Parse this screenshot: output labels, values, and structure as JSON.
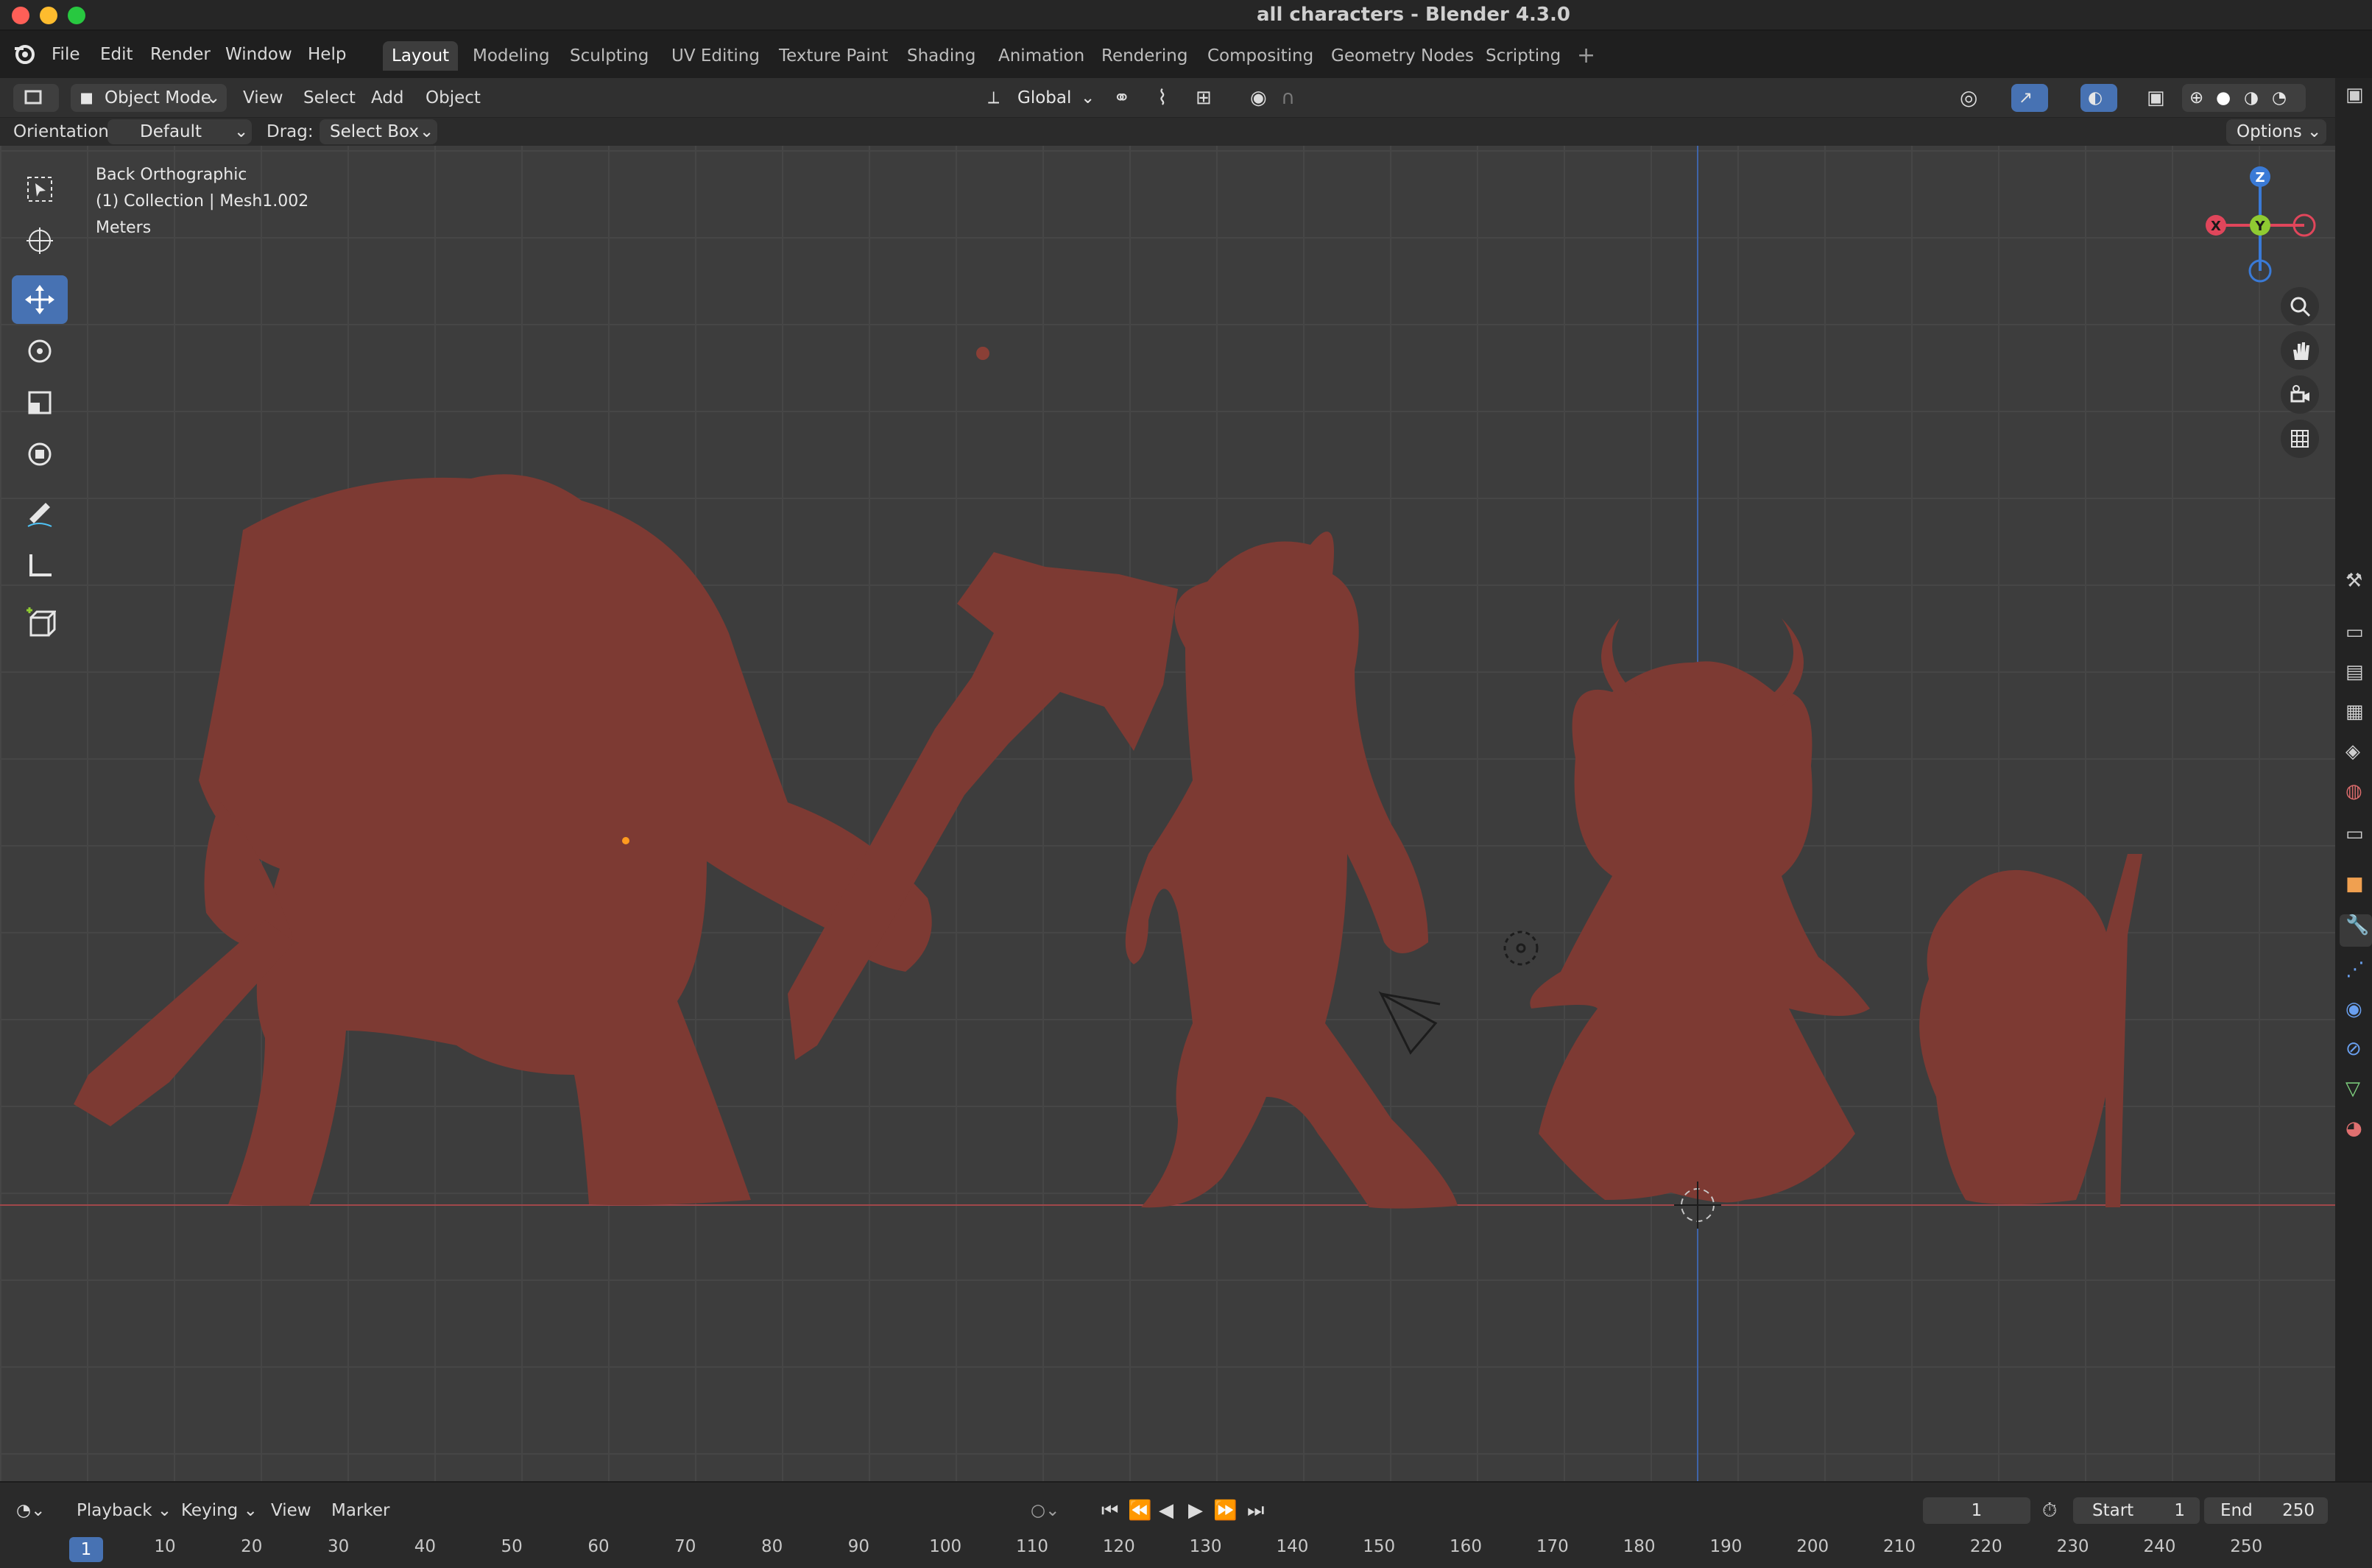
{
  "window": {
    "title": "all characters - Blender 4.3.0"
  },
  "menu": [
    {
      "name": "file",
      "label": "File"
    },
    {
      "name": "edit",
      "label": "Edit"
    },
    {
      "name": "render",
      "label": "Render"
    },
    {
      "name": "window",
      "label": "Window"
    },
    {
      "name": "help",
      "label": "Help"
    }
  ],
  "workspaces": [
    {
      "name": "layout",
      "label": "Layout"
    },
    {
      "name": "modeling",
      "label": "Modeling"
    },
    {
      "name": "sculpting",
      "label": "Sculpting"
    },
    {
      "name": "uv-editing",
      "label": "UV Editing"
    },
    {
      "name": "texture-paint",
      "label": "Texture Paint"
    },
    {
      "name": "shading",
      "label": "Shading"
    },
    {
      "name": "animation",
      "label": "Animation"
    },
    {
      "name": "rendering",
      "label": "Rendering"
    },
    {
      "name": "compositing",
      "label": "Compositing"
    },
    {
      "name": "geometry-nodes",
      "label": "Geometry Nodes"
    },
    {
      "name": "scripting",
      "label": "Scripting"
    }
  ],
  "header": {
    "mode": "Object Mode",
    "view": "View",
    "select": "Select",
    "add": "Add",
    "object": "Object",
    "transform": "Global"
  },
  "tool_settings": {
    "orientation_label": "Orientation:",
    "orientation_value": "Default",
    "drag_label": "Drag:",
    "drag_value": "Select Box",
    "options": "Options"
  },
  "viewport_info": {
    "view": "Back Orthographic",
    "collection": "(1) Collection | Mesh1.002",
    "units": "Meters"
  },
  "gizmo": {
    "z": "Z",
    "y": "Y",
    "x": "X"
  },
  "timeline": {
    "playback": "Playback",
    "keying": "Keying",
    "view": "View",
    "marker": "Marker",
    "current_frame": "1",
    "start_label": "Start",
    "start": "1",
    "end_label": "End",
    "end": "250",
    "ticks": [
      "10",
      "20",
      "30",
      "40",
      "50",
      "60",
      "70",
      "80",
      "90",
      "100",
      "110",
      "120",
      "130",
      "140",
      "150",
      "160",
      "170",
      "180",
      "190",
      "200",
      "210",
      "220",
      "230",
      "240",
      "250"
    ],
    "cursor_frame": "1"
  },
  "colors": {
    "accent": "#4772b3",
    "mesh": "#7d3a33",
    "x_axis": "#e0465b",
    "y_axis": "#8fcb32",
    "z_axis": "#3a7ad6"
  }
}
